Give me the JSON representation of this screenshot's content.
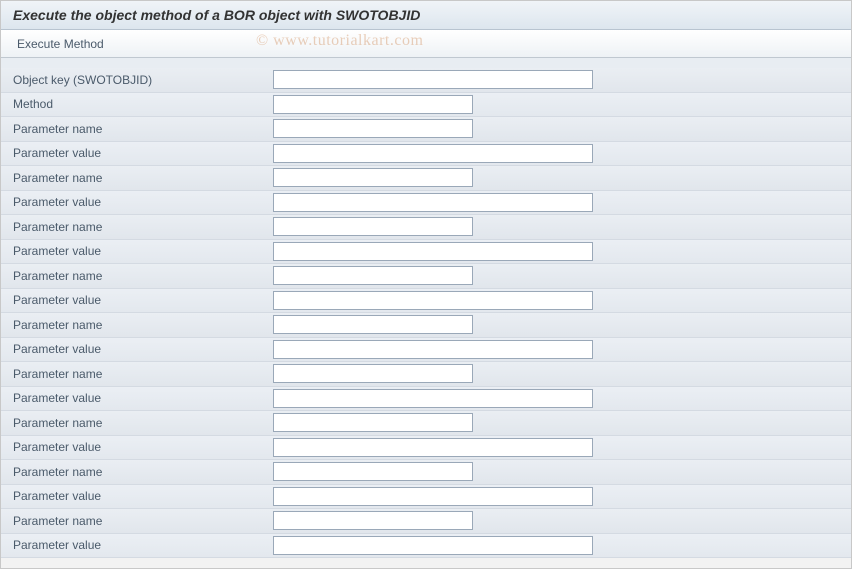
{
  "header": {
    "title": "Execute the object method of a BOR object with SWOTOBJID"
  },
  "toolbar": {
    "execute_label": "Execute Method"
  },
  "watermark": "© www.tutorialkart.com",
  "form": {
    "rows": [
      {
        "label": "Object key (SWOTOBJID)",
        "value": "",
        "width": "wide"
      },
      {
        "label": "Method",
        "value": "",
        "width": "medium"
      },
      {
        "label": "Parameter name",
        "value": "",
        "width": "medium"
      },
      {
        "label": "Parameter value",
        "value": "",
        "width": "wide"
      },
      {
        "label": "Parameter name",
        "value": "",
        "width": "medium"
      },
      {
        "label": "Parameter value",
        "value": "",
        "width": "wide"
      },
      {
        "label": "Parameter name",
        "value": "",
        "width": "medium"
      },
      {
        "label": "Parameter value",
        "value": "",
        "width": "wide"
      },
      {
        "label": "Parameter name",
        "value": "",
        "width": "medium"
      },
      {
        "label": "Parameter value",
        "value": "",
        "width": "wide"
      },
      {
        "label": "Parameter name",
        "value": "",
        "width": "medium"
      },
      {
        "label": "Parameter value",
        "value": "",
        "width": "wide"
      },
      {
        "label": "Parameter name",
        "value": "",
        "width": "medium"
      },
      {
        "label": "Parameter value",
        "value": "",
        "width": "wide"
      },
      {
        "label": "Parameter name",
        "value": "",
        "width": "medium"
      },
      {
        "label": "Parameter value",
        "value": "",
        "width": "wide"
      },
      {
        "label": "Parameter name",
        "value": "",
        "width": "medium"
      },
      {
        "label": "Parameter value",
        "value": "",
        "width": "wide"
      },
      {
        "label": "Parameter name",
        "value": "",
        "width": "medium"
      },
      {
        "label": "Parameter value",
        "value": "",
        "width": "wide"
      }
    ]
  }
}
